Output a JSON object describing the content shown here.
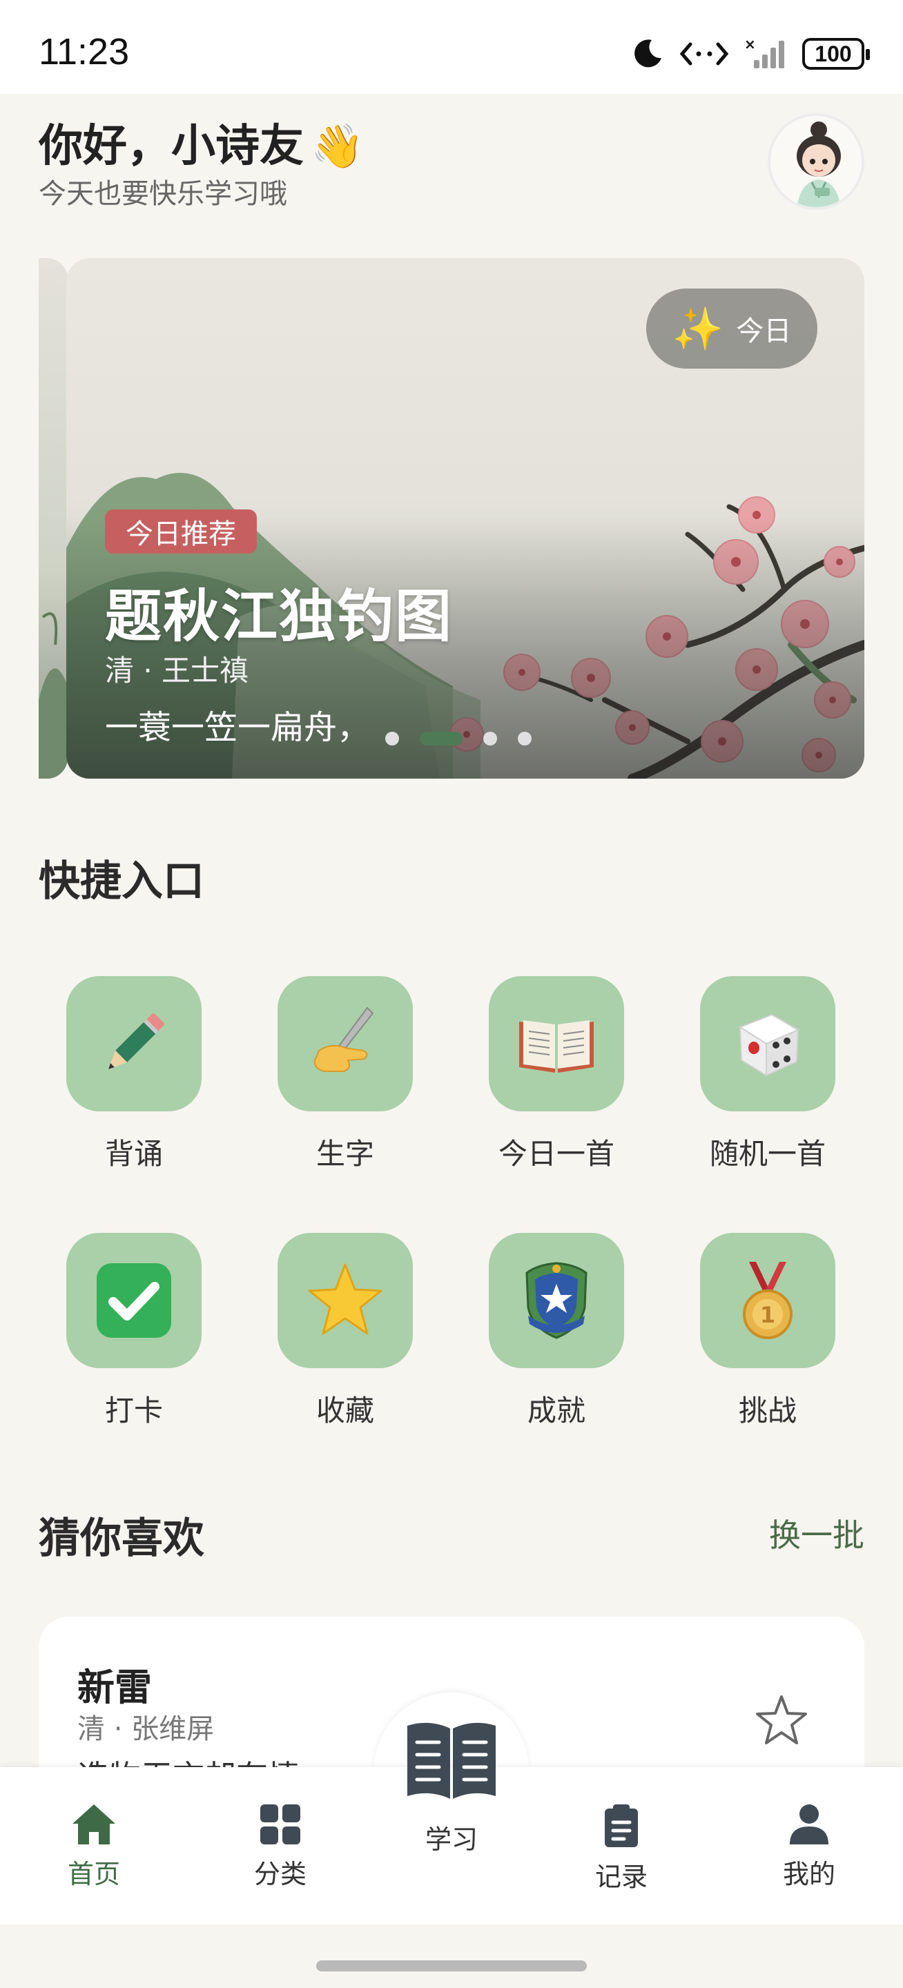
{
  "status_bar": {
    "time": "11:23",
    "battery": "100",
    "icons": [
      "moon-icon",
      "data-transfer-icon",
      "signal-icon",
      "battery-icon"
    ]
  },
  "header": {
    "greeting": "你好，小诗友",
    "greeting_emoji": "👋",
    "subtitle": "今天也要快乐学习哦"
  },
  "banner": {
    "chip_label": "今日",
    "badge": "今日推荐",
    "title": "题秋江独钓图",
    "author": "清 · 王士禛",
    "first_line": "一蓑一笠一扁舟，",
    "pages": 4,
    "active_page": 2
  },
  "quick_access": {
    "title": "快捷入口",
    "items": [
      {
        "label": "背诵",
        "icon": "pencil-icon"
      },
      {
        "label": "生字",
        "icon": "writing-hand-icon"
      },
      {
        "label": "今日一首",
        "icon": "open-book-icon"
      },
      {
        "label": "随机一首",
        "icon": "dice-icon"
      },
      {
        "label": "打卡",
        "icon": "check-mark-icon"
      },
      {
        "label": "收藏",
        "icon": "star-icon"
      },
      {
        "label": "成就",
        "icon": "badge-icon"
      },
      {
        "label": "挑战",
        "icon": "medal-icon"
      }
    ]
  },
  "recommend": {
    "title": "猜你喜欢",
    "action": "换一批",
    "card": {
      "title": "新雷",
      "author": "清 · 张维屏",
      "line": "造物无言却有情，"
    }
  },
  "bottom_nav": {
    "items": [
      {
        "label": "首页",
        "icon": "home-icon",
        "active": true
      },
      {
        "label": "分类",
        "icon": "grid-icon",
        "active": false
      },
      {
        "label": "学习",
        "icon": "book-icon",
        "active": false
      },
      {
        "label": "记录",
        "icon": "clipboard-icon",
        "active": false
      },
      {
        "label": "我的",
        "icon": "person-icon",
        "active": false
      }
    ]
  },
  "colors": {
    "accent_green": "#3e6b45",
    "tile_green": "#a9d0a8",
    "badge_red": "#c66060",
    "background": "#f7f5f0"
  }
}
